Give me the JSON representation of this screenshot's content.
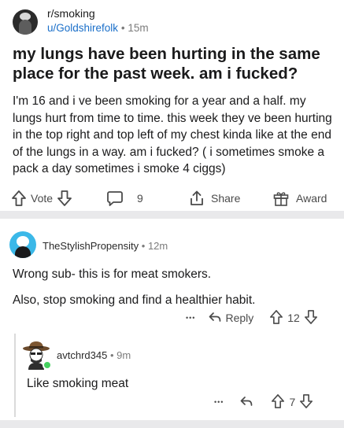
{
  "post": {
    "subreddit": "r/smoking",
    "author": "u/Goldshirefolk",
    "separator": "•",
    "time": "15m",
    "title": "my lungs have been hurting in the same place for the past week. am i fucked?",
    "body": "I'm 16 and i ve been smoking for a year and a half. my lungs hurt from time to time. this week they ve been hurting in the top right and top left of my chest kinda like at the end of the lungs in a way. am i fucked? ( i sometimes smoke a pack a day sometimes i smoke 4 ciggs)",
    "vote_label": "Vote",
    "comment_count": "9",
    "share_label": "Share",
    "award_label": "Award"
  },
  "comments": [
    {
      "author": "TheStylishPropensity",
      "separator": "•",
      "time": "12m",
      "text_1": "Wrong sub- this is for meat smokers.",
      "text_2": "Also, stop smoking and find a healthier habit.",
      "more_label": "•••",
      "reply_label": "Reply",
      "score": "12"
    },
    {
      "author": "avtchrd345",
      "separator": "•",
      "time": "9m",
      "text": "Like smoking meat",
      "more_label": "•••",
      "score": "7"
    }
  ],
  "icons": {
    "upvote": "arrow-up-outline-icon",
    "downvote": "arrow-down-outline-icon",
    "comment": "speech-bubble-icon",
    "share": "share-upload-icon",
    "award": "gift-icon",
    "reply": "reply-arrow-icon"
  },
  "colors": {
    "link_blue": "#1a6fc9",
    "meta_gray": "#7c7c7c",
    "divider": "#e9e9eb",
    "online_green": "#46d160",
    "avatar_blue": "#3bb8e8"
  }
}
